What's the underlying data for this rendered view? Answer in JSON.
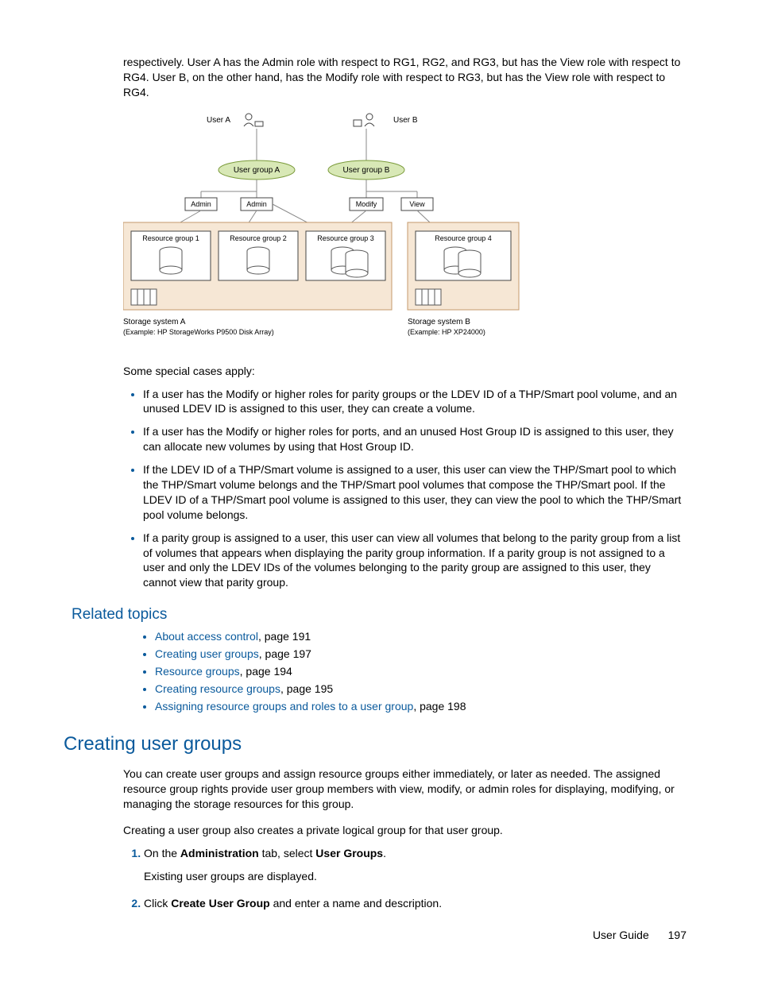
{
  "intro_continuation": "respectively. User A has the Admin role with respect to RG1, RG2, and RG3, but has the View role with respect to RG4. User B, on the other hand, has the Modify role with respect to RG3, but has the View role with respect to RG4.",
  "diagram": {
    "userA": "User A",
    "userB": "User B",
    "groupA": "User group A",
    "groupB": "User group B",
    "roles": {
      "admin1": "Admin",
      "admin2": "Admin",
      "modify": "Modify",
      "view": "View"
    },
    "rg1": "Resource group 1",
    "rg2": "Resource group 2",
    "rg3": "Resource group 3",
    "rg4": "Resource group 4",
    "storageA_t": "Storage system A",
    "storageA_d": "(Example: HP StorageWorks P9500 Disk Array)",
    "storageB_t": "Storage system B",
    "storageB_d": "(Example: HP XP24000)"
  },
  "special_lead": "Some special cases apply:",
  "special_cases": [
    "If a user has the Modify or higher roles for parity groups or the LDEV ID of a THP/Smart pool volume, and an unused LDEV ID is assigned to this user, they can create a volume.",
    "If a user has the Modify or higher roles for ports, and an unused Host Group ID is assigned to this user, they can allocate new volumes by using that Host Group ID.",
    "If the LDEV ID of a THP/Smart volume is assigned to a user, this user can view the THP/Smart pool to which the THP/Smart volume belongs and the THP/Smart pool volumes that compose the THP/Smart pool. If the LDEV ID of a THP/Smart pool volume is assigned to this user, they can view the pool to which the THP/Smart pool volume belongs.",
    "If a parity group is assigned to a user, this user can view all volumes that belong to the parity group from a list of volumes that appears when displaying the parity group information. If a parity group is not assigned to a user and only the LDEV IDs of the volumes belonging to the parity group are assigned to this user, they cannot view that parity group."
  ],
  "related_heading": "Related topics",
  "related": [
    {
      "link": "About access control",
      "suffix": ", page 191"
    },
    {
      "link": "Creating user groups",
      "suffix": ", page 197"
    },
    {
      "link": "Resource groups",
      "suffix": ", page 194"
    },
    {
      "link": "Creating resource groups",
      "suffix": ", page 195"
    },
    {
      "link": "Assigning resource groups and roles to a user group",
      "suffix": ", page 198"
    }
  ],
  "h1": "Creating user groups",
  "create_p1": "You can create user groups and assign resource groups either immediately, or later as needed. The assigned resource group rights provide user group members with view, modify, or admin roles for displaying, modifying, or managing the storage resources for this group.",
  "create_p2": "Creating a user group also creates a private logical group for that user group.",
  "steps": {
    "s1_a": "On the ",
    "s1_b": "Administration",
    "s1_c": " tab, select ",
    "s1_d": "User Groups",
    "s1_e": ".",
    "s1_sub": "Existing user groups are displayed.",
    "s2_a": "Click ",
    "s2_b": "Create User Group",
    "s2_c": " and enter a name and description."
  },
  "footer_label": "User Guide",
  "footer_page": "197"
}
